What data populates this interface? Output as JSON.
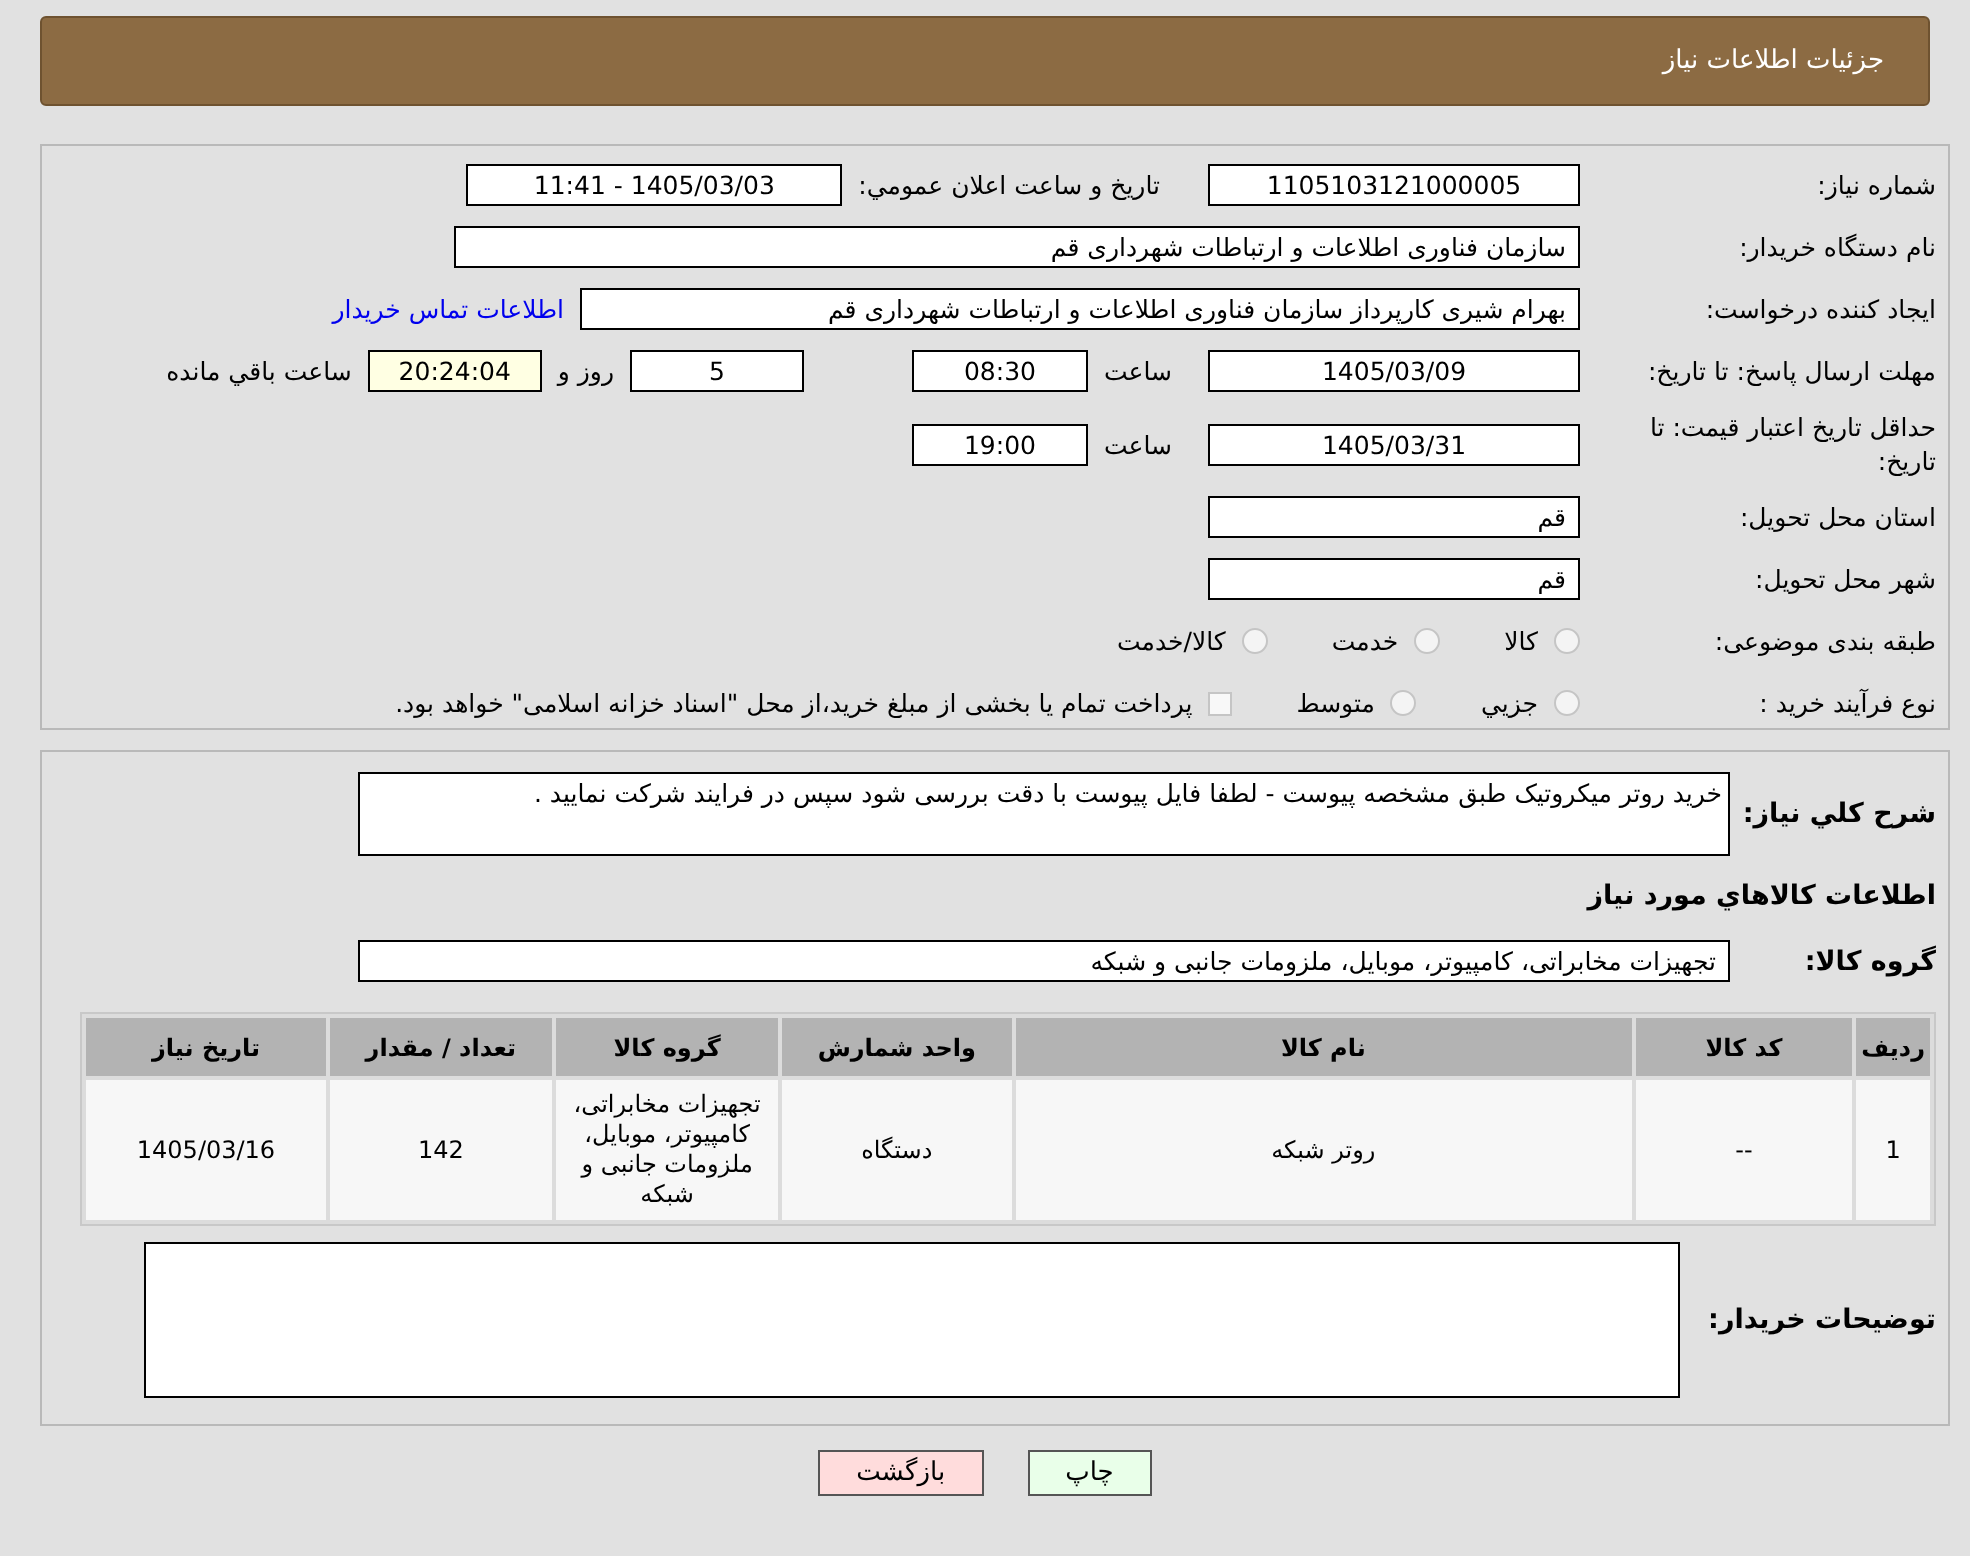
{
  "header": {
    "title": "جزئيات اطلاعات نياز"
  },
  "need_number": {
    "label": "شماره نياز:",
    "value": "1105103121000005"
  },
  "announce": {
    "label": "تاريخ و ساعت اعلان عمومي:",
    "value": "1405/03/03 - 11:41"
  },
  "buyer_org": {
    "label": "نام دستگاه خريدار:",
    "value": "سازمان فناوری اطلاعات و ارتباطات شهرداری قم"
  },
  "requester": {
    "label": "ايجاد کننده درخواست:",
    "value": "بهرام شیری کارپرداز سازمان فناوری اطلاعات و ارتباطات شهرداری قم",
    "link": "اطلاعات تماس خريدار"
  },
  "deadline": {
    "label": "مهلت ارسال پاسخ: تا تاریخ:",
    "date": "1405/03/09",
    "time_label": "ساعت",
    "time": "08:30",
    "days": "5",
    "days_label": "روز و",
    "remaining": "20:24:04",
    "remaining_label": "ساعت باقي مانده"
  },
  "price_validity": {
    "label": "حداقل تاريخ اعتبار قيمت: تا تاريخ:",
    "date": "1405/03/31",
    "time_label": "ساعت",
    "time": "19:00"
  },
  "province": {
    "label": "استان محل تحويل:",
    "value": "قم"
  },
  "city": {
    "label": "شهر محل تحويل:",
    "value": "قم"
  },
  "category": {
    "label": "طبقه بندی موضوعی:",
    "options": [
      {
        "label": "کالا",
        "kind": "radio",
        "selected": false
      },
      {
        "label": "خدمت",
        "kind": "radio",
        "selected": false
      },
      {
        "label": "کالا/خدمت",
        "kind": "radio",
        "selected": false
      }
    ]
  },
  "purchase_type": {
    "label": "نوع فرآيند خريد :",
    "options": [
      {
        "label": "جزيي",
        "kind": "radio",
        "selected": false
      },
      {
        "label": "متوسط",
        "kind": "radio",
        "selected": false
      },
      {
        "label": "پرداخت تمام يا بخشی از مبلغ خريد،از محل \"اسناد خزانه اسلامی\" خواهد بود.",
        "kind": "checkbox",
        "selected": false
      }
    ]
  },
  "description": {
    "label": "شرح کلي نياز:",
    "value": "خريد روتر ميکروتيک طبق مشخصه پيوست - لطفا فايل پيوست با دقت بررسی شود سپس در فرايند شرکت نماييد ."
  },
  "goods_heading": "اطلاعات کالاهاي مورد نياز",
  "goods_group": {
    "label": "گروه کالا:",
    "value": "تجهيزات مخابراتی، کامپيوتر، موبايل، ملزومات جانبی و شبکه"
  },
  "table": {
    "columns": [
      "رديف",
      "کد کالا",
      "نام کالا",
      "واحد شمارش",
      "گروه کالا",
      "تعداد / مقدار",
      "تاريخ نياز"
    ],
    "rows": [
      [
        "1",
        "--",
        "روتر شبکه",
        "دستگاه",
        "تجهيزات مخابراتی، کامپيوتر، موبايل، ملزومات جانبی و شبکه",
        "142",
        "1405/03/16"
      ]
    ]
  },
  "buyer_notes": {
    "label": "توضيحات خريدار:"
  },
  "buttons": [
    {
      "label": "چاپ",
      "kind": "print"
    },
    {
      "label": "بازگشت",
      "kind": "back"
    }
  ]
}
